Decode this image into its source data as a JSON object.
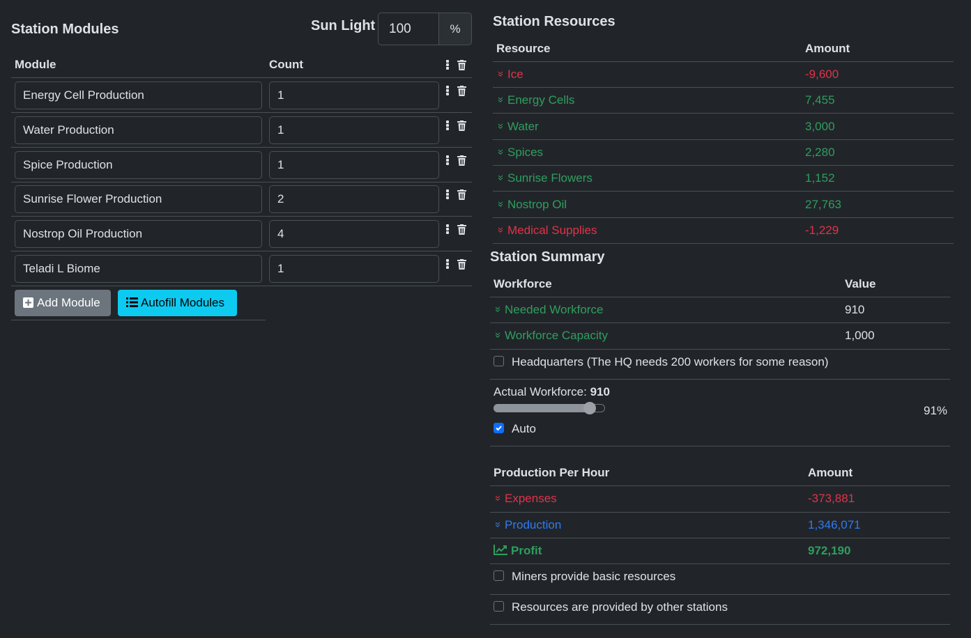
{
  "modules": {
    "title": "Station Modules",
    "sunlight_label": "Sun Light",
    "sunlight_value": "100",
    "sunlight_unit": "%",
    "col_module": "Module",
    "col_count": "Count",
    "rows": [
      {
        "name": "Energy Cell Production",
        "count": "1"
      },
      {
        "name": "Water Production",
        "count": "1"
      },
      {
        "name": "Spice Production",
        "count": "1"
      },
      {
        "name": "Sunrise Flower Production",
        "count": "2"
      },
      {
        "name": "Nostrop Oil Production",
        "count": "4"
      },
      {
        "name": "Teladi L Biome",
        "count": "1"
      }
    ],
    "add_button": "Add Module",
    "autofill_button": "Autofill Modules"
  },
  "resources": {
    "title": "Station Resources",
    "col_resource": "Resource",
    "col_amount": "Amount",
    "rows": [
      {
        "name": "Ice",
        "amount": "-9,600",
        "status": "negative"
      },
      {
        "name": "Energy Cells",
        "amount": "7,455",
        "status": "positive"
      },
      {
        "name": "Water",
        "amount": "3,000",
        "status": "positive"
      },
      {
        "name": "Spices",
        "amount": "2,280",
        "status": "positive"
      },
      {
        "name": "Sunrise Flowers",
        "amount": "1,152",
        "status": "positive"
      },
      {
        "name": "Nostrop Oil",
        "amount": "27,763",
        "status": "positive"
      },
      {
        "name": "Medical Supplies",
        "amount": "-1,229",
        "status": "negative"
      }
    ]
  },
  "summary": {
    "title": "Station Summary",
    "col_workforce": "Workforce",
    "col_value": "Value",
    "needed_label": "Needed Workforce",
    "needed_value": "910",
    "capacity_label": "Workforce Capacity",
    "capacity_value": "1,000",
    "hq_label": "Headquarters (The HQ needs 200 workers for some reason)",
    "hq_checked": false,
    "actual_label": "Actual Workforce: ",
    "actual_value": "910",
    "slider_fraction": 0.91,
    "slider_percent": "91%",
    "auto_label": "Auto",
    "auto_checked": true,
    "col_production": "Production Per Hour",
    "col_amount": "Amount",
    "expenses_label": "Expenses",
    "expenses_value": "-373,881",
    "production_label": "Production",
    "production_value": "1,346,071",
    "profit_label": "Profit",
    "profit_value": "972,190",
    "miners_label": "Miners provide basic resources",
    "miners_checked": false,
    "other_label": "Resources are provided by other stations",
    "other_checked": false
  },
  "colors": {
    "background": "#212529",
    "positive": "#2f9e5e",
    "negative": "#e0334a",
    "production": "#2f7bf2",
    "accent_cyan": "#0dcaf0",
    "checkbox_blue": "#0d6efd"
  }
}
